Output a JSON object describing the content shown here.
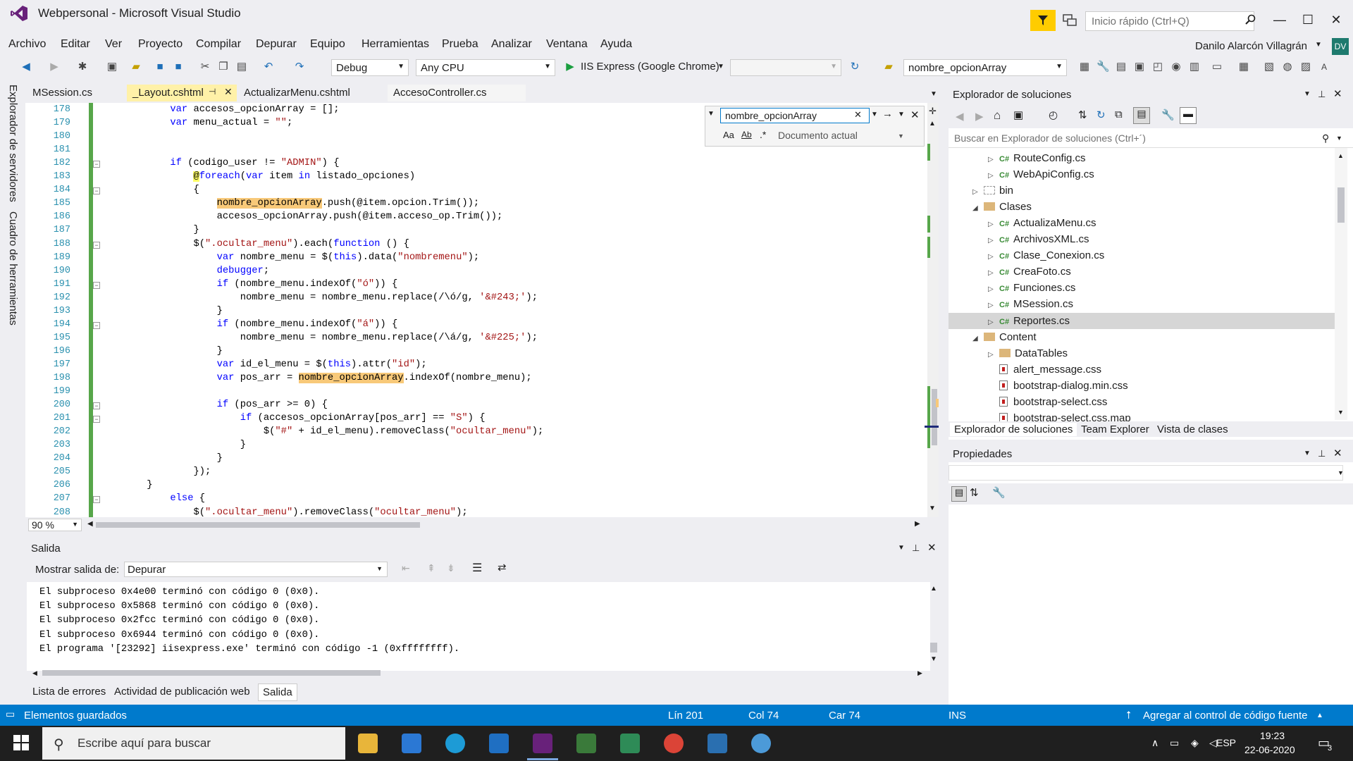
{
  "window": {
    "title": "Webpersonal - Microsoft Visual Studio",
    "quick_launch_placeholder": "Inicio rápido (Ctrl+Q)",
    "user_name": "Danilo Alarcón Villagrán",
    "user_initials": "DV"
  },
  "menu": [
    "Archivo",
    "Editar",
    "Ver",
    "Proyecto",
    "Compilar",
    "Depurar",
    "Equipo",
    "Herramientas",
    "Prueba",
    "Analizar",
    "Ventana",
    "Ayuda"
  ],
  "toolbar": {
    "config": "Debug",
    "platform": "Any CPU",
    "run_target": "IIS Express (Google Chrome)",
    "find_combo": "nombre_opcionArray"
  },
  "side_tabs": [
    "Explorador de servidores",
    "Cuadro de herramientas"
  ],
  "doc_tabs": [
    {
      "label": "MSession.cs"
    },
    {
      "label": "_Layout.cshtml"
    },
    {
      "label": "ActualizarMenu.cshtml"
    },
    {
      "label": "AccesoController.cs"
    }
  ],
  "find": {
    "query": "nombre_opcionArray",
    "scope": "Documento actual"
  },
  "code": {
    "lines": [
      {
        "n": "178",
        "text": "            var accesos_opcionArray = [];"
      },
      {
        "n": "179",
        "text": "            var menu_actual = \"\";"
      },
      {
        "n": "180",
        "text": ""
      },
      {
        "n": "181",
        "text": ""
      },
      {
        "n": "182",
        "text": "            if (codigo_user != \"ADMIN\") {"
      },
      {
        "n": "183",
        "text": "                @foreach(var item in listado_opciones)"
      },
      {
        "n": "184",
        "text": "                {"
      },
      {
        "n": "185",
        "text": "                    nombre_opcionArray.push(@item.opcion.Trim());"
      },
      {
        "n": "186",
        "text": "                    accesos_opcionArray.push(@item.acceso_op.Trim());"
      },
      {
        "n": "187",
        "text": "                }"
      },
      {
        "n": "188",
        "text": "                $(\".ocultar_menu\").each(function () {"
      },
      {
        "n": "189",
        "text": "                    var nombre_menu = $(this).data(\"nombremenu\");"
      },
      {
        "n": "190",
        "text": "                    debugger;"
      },
      {
        "n": "191",
        "text": "                    if (nombre_menu.indexOf(\"ó\")) {"
      },
      {
        "n": "192",
        "text": "                        nombre_menu = nombre_menu.replace(/\\ó/g, '&#243;');"
      },
      {
        "n": "193",
        "text": "                    }"
      },
      {
        "n": "194",
        "text": "                    if (nombre_menu.indexOf(\"á\")) {"
      },
      {
        "n": "195",
        "text": "                        nombre_menu = nombre_menu.replace(/\\á/g, '&#225;');"
      },
      {
        "n": "196",
        "text": "                    }"
      },
      {
        "n": "197",
        "text": "                    var id_el_menu = $(this).attr(\"id\");"
      },
      {
        "n": "198",
        "text": "                    var pos_arr = nombre_opcionArray.indexOf(nombre_menu);"
      },
      {
        "n": "199",
        "text": ""
      },
      {
        "n": "200",
        "text": "                    if (pos_arr >= 0) {"
      },
      {
        "n": "201",
        "text": "                        if (accesos_opcionArray[pos_arr] == \"S\") {"
      },
      {
        "n": "202",
        "text": "                            $(\"#\" + id_el_menu).removeClass(\"ocultar_menu\");"
      },
      {
        "n": "203",
        "text": "                        }"
      },
      {
        "n": "204",
        "text": "                    }"
      },
      {
        "n": "205",
        "text": "                });"
      },
      {
        "n": "206",
        "text": "        }"
      },
      {
        "n": "207",
        "text": "            else {"
      },
      {
        "n": "208",
        "text": "                $(\".ocultar_menu\").removeClass(\"ocultar_menu\");"
      }
    ]
  },
  "zoom": "90 %",
  "output": {
    "title": "Salida",
    "show_label": "Mostrar salida de:",
    "source": "Depurar",
    "lines": [
      "El subproceso 0x4e00 terminó con código 0 (0x0).",
      "El subproceso 0x5868 terminó con código 0 (0x0).",
      "El subproceso 0x2fcc terminó con código 0 (0x0).",
      "El subproceso 0x6944 terminó con código 0 (0x0).",
      "El programa '[23292] iisexpress.exe' terminó con código -1 (0xffffffff)."
    ]
  },
  "bottom_tabs": [
    "Lista de errores",
    "Actividad de publicación web",
    "Salida"
  ],
  "solution": {
    "title": "Explorador de soluciones",
    "search_placeholder": "Buscar en Explorador de soluciones (Ctrl+´)",
    "items": [
      {
        "label": "RouteConfig.cs",
        "kind": "cs",
        "indent": 2,
        "exp": "right"
      },
      {
        "label": "WebApiConfig.cs",
        "kind": "cs",
        "indent": 2,
        "exp": "right"
      },
      {
        "label": "bin",
        "kind": "folder-hidden",
        "indent": 1,
        "exp": "right"
      },
      {
        "label": "Clases",
        "kind": "folder",
        "indent": 1,
        "exp": "down"
      },
      {
        "label": "ActualizaMenu.cs",
        "kind": "cs",
        "indent": 2,
        "exp": "right"
      },
      {
        "label": "ArchivosXML.cs",
        "kind": "cs",
        "indent": 2,
        "exp": "right"
      },
      {
        "label": "Clase_Conexion.cs",
        "kind": "cs",
        "indent": 2,
        "exp": "right"
      },
      {
        "label": "CreaFoto.cs",
        "kind": "cs",
        "indent": 2,
        "exp": "right"
      },
      {
        "label": "Funciones.cs",
        "kind": "cs",
        "indent": 2,
        "exp": "right"
      },
      {
        "label": "MSession.cs",
        "kind": "cs",
        "indent": 2,
        "exp": "right"
      },
      {
        "label": "Reportes.cs",
        "kind": "cs",
        "indent": 2,
        "exp": "right"
      },
      {
        "label": "Content",
        "kind": "folder",
        "indent": 1,
        "exp": "down"
      },
      {
        "label": "DataTables",
        "kind": "folder",
        "indent": 2,
        "exp": "right"
      },
      {
        "label": "alert_message.css",
        "kind": "css",
        "indent": 2,
        "exp": ""
      },
      {
        "label": "bootstrap-dialog.min.css",
        "kind": "css",
        "indent": 2,
        "exp": ""
      },
      {
        "label": "bootstrap-select.css",
        "kind": "css",
        "indent": 2,
        "exp": ""
      },
      {
        "label": "bootstrap-select.css.map",
        "kind": "css",
        "indent": 2,
        "exp": ""
      }
    ],
    "tabs": [
      "Explorador de soluciones",
      "Team Explorer",
      "Vista de clases"
    ]
  },
  "properties": {
    "title": "Propiedades"
  },
  "status": {
    "message": "Elementos guardados",
    "line": "Lín 201",
    "col": "Col 74",
    "car": "Car 74",
    "mode": "INS",
    "source_control": "Agregar al control de código fuente"
  },
  "taskbar": {
    "search_placeholder": "Escribe aquí para buscar",
    "lang": "ESP",
    "time": "19:23",
    "date": "22-06-2020",
    "notifications": "3"
  },
  "colors": {
    "accent": "#007acc",
    "highlight": "#f8c979",
    "brand": "#68217a"
  }
}
